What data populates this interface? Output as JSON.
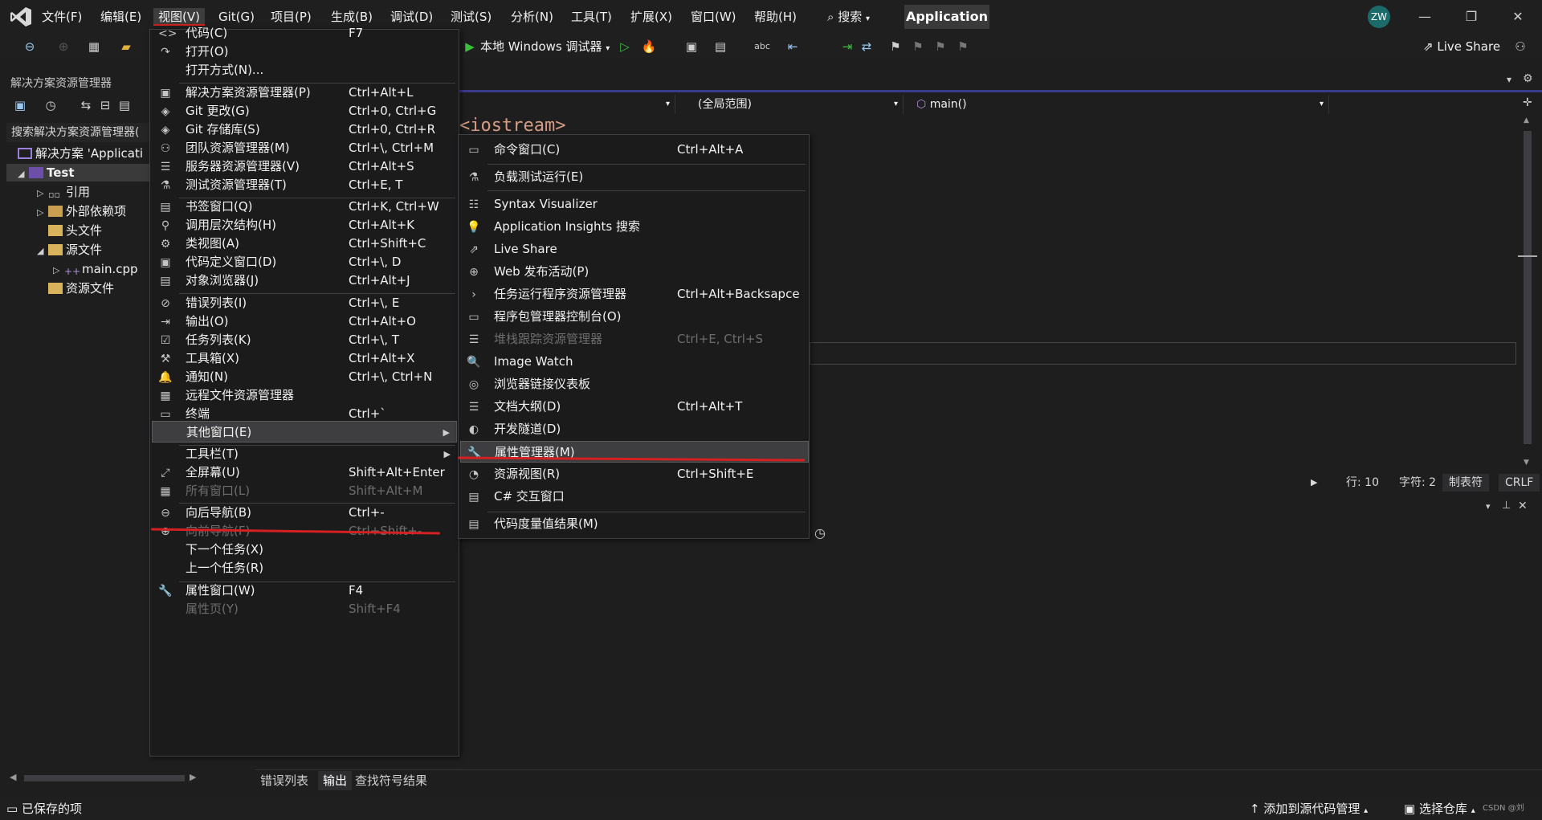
{
  "menubar": {
    "items": [
      "文件(F)",
      "编辑(E)",
      "视图(V)",
      "Git(G)",
      "项目(P)",
      "生成(B)",
      "调试(D)",
      "测试(S)",
      "分析(N)",
      "工具(T)",
      "扩展(X)",
      "窗口(W)",
      "帮助(H)"
    ],
    "search_label": "搜索",
    "app_title": "Application",
    "avatar_initials": "ZW"
  },
  "toolbar": {
    "debugger_label": "本地 Windows 调试器",
    "live_share_label": "Live Share"
  },
  "solution_explorer": {
    "title": "解决方案资源管理器",
    "search_placeholder": "搜索解决方案资源管理器(",
    "tree": [
      {
        "label": "解决方案 'Applicati",
        "level": 0,
        "arrow": ""
      },
      {
        "label": "Test",
        "level": 0,
        "arrow": "◢",
        "selected": true
      },
      {
        "label": "引用",
        "level": 1,
        "arrow": "▷"
      },
      {
        "label": "外部依赖项",
        "level": 1,
        "arrow": "▷"
      },
      {
        "label": "头文件",
        "level": 1,
        "arrow": ""
      },
      {
        "label": "源文件",
        "level": 1,
        "arrow": "◢"
      },
      {
        "label": "main.cpp",
        "level": 2,
        "arrow": "▷"
      },
      {
        "label": "资源文件",
        "level": 1,
        "arrow": ""
      }
    ]
  },
  "editor": {
    "scope_label": "(全局范围)",
    "function_label": "main()",
    "code_fragment": "<iostream>",
    "status": {
      "line": "行: 10",
      "char": "字符: 2",
      "tabs": "制表符",
      "eol": "CRLF"
    }
  },
  "output_tabs": [
    "错误列表",
    "输出",
    "查找符号结果"
  ],
  "statusbar": {
    "saved": "已保存的项",
    "add_source_control": "添加到源代码管理",
    "select_repo": "选择仓库",
    "watermark": "CSDN @刘"
  },
  "view_menu": {
    "items": [
      {
        "label": "代码(C)",
        "shortcut": "F7",
        "icon": "<>"
      },
      {
        "label": "打开(O)",
        "shortcut": "",
        "icon": "↷"
      },
      {
        "label": "打开方式(N)...",
        "shortcut": "",
        "icon": ""
      },
      {
        "label": "解决方案资源管理器(P)",
        "shortcut": "Ctrl+Alt+L",
        "icon": "▣"
      },
      {
        "label": "Git 更改(G)",
        "shortcut": "Ctrl+0, Ctrl+G",
        "icon": "◈"
      },
      {
        "label": "Git 存储库(S)",
        "shortcut": "Ctrl+0, Ctrl+R",
        "icon": "◈"
      },
      {
        "label": "团队资源管理器(M)",
        "shortcut": "Ctrl+\\, Ctrl+M",
        "icon": "⚇"
      },
      {
        "label": "服务器资源管理器(V)",
        "shortcut": "Ctrl+Alt+S",
        "icon": "☰"
      },
      {
        "label": "测试资源管理器(T)",
        "shortcut": "Ctrl+E, T",
        "icon": "⚗"
      },
      {
        "label": "书签窗口(Q)",
        "shortcut": "Ctrl+K, Ctrl+W",
        "icon": "▤"
      },
      {
        "label": "调用层次结构(H)",
        "shortcut": "Ctrl+Alt+K",
        "icon": "⚲"
      },
      {
        "label": "类视图(A)",
        "shortcut": "Ctrl+Shift+C",
        "icon": "⚙"
      },
      {
        "label": "代码定义窗口(D)",
        "shortcut": "Ctrl+\\, D",
        "icon": "▣"
      },
      {
        "label": "对象浏览器(J)",
        "shortcut": "Ctrl+Alt+J",
        "icon": "▤"
      },
      {
        "label": "错误列表(I)",
        "shortcut": "Ctrl+\\, E",
        "icon": "⊘"
      },
      {
        "label": "输出(O)",
        "shortcut": "Ctrl+Alt+O",
        "icon": "⇥"
      },
      {
        "label": "任务列表(K)",
        "shortcut": "Ctrl+\\, T",
        "icon": "☑"
      },
      {
        "label": "工具箱(X)",
        "shortcut": "Ctrl+Alt+X",
        "icon": "⚒"
      },
      {
        "label": "通知(N)",
        "shortcut": "Ctrl+\\, Ctrl+N",
        "icon": "🔔"
      },
      {
        "label": "远程文件资源管理器",
        "shortcut": "",
        "icon": "▦"
      },
      {
        "label": "终端",
        "shortcut": "Ctrl+`",
        "icon": "▭"
      },
      {
        "label": "其他窗口(E)",
        "shortcut": "",
        "icon": ""
      },
      {
        "label": "工具栏(T)",
        "shortcut": "",
        "icon": ""
      },
      {
        "label": "全屏幕(U)",
        "shortcut": "Shift+Alt+Enter",
        "icon": "⤢"
      },
      {
        "label": "所有窗口(L)",
        "shortcut": "Shift+Alt+M",
        "icon": "▦"
      },
      {
        "label": "向后导航(B)",
        "shortcut": "Ctrl+-",
        "icon": "⊖"
      },
      {
        "label": "向前导航(F)",
        "shortcut": "Ctrl+Shift+-",
        "icon": "⊕"
      },
      {
        "label": "下一个任务(X)",
        "shortcut": "",
        "icon": ""
      },
      {
        "label": "上一个任务(R)",
        "shortcut": "",
        "icon": ""
      },
      {
        "label": "属性窗口(W)",
        "shortcut": "F4",
        "icon": "🔧"
      },
      {
        "label": "属性页(Y)",
        "shortcut": "Shift+F4",
        "icon": ""
      }
    ]
  },
  "other_windows_menu": {
    "items": [
      {
        "label": "命令窗口(C)",
        "shortcut": "Ctrl+Alt+A",
        "icon": "▭"
      },
      {
        "label": "负载测试运行(E)",
        "shortcut": "",
        "icon": "⚗"
      },
      {
        "label": "Syntax Visualizer",
        "shortcut": "",
        "icon": "☷"
      },
      {
        "label": "Application Insights 搜索",
        "shortcut": "",
        "icon": "💡"
      },
      {
        "label": "Live Share",
        "shortcut": "",
        "icon": "⇗"
      },
      {
        "label": "Web 发布活动(P)",
        "shortcut": "",
        "icon": "⊕"
      },
      {
        "label": "任务运行程序资源管理器",
        "shortcut": "Ctrl+Alt+Backsapce",
        "icon": "›"
      },
      {
        "label": "程序包管理器控制台(O)",
        "shortcut": "",
        "icon": "▭"
      },
      {
        "label": "堆栈跟踪资源管理器",
        "shortcut": "Ctrl+E, Ctrl+S",
        "icon": "☰"
      },
      {
        "label": "Image Watch",
        "shortcut": "",
        "icon": "🔍"
      },
      {
        "label": "浏览器链接仪表板",
        "shortcut": "",
        "icon": "◎"
      },
      {
        "label": "文档大纲(D)",
        "shortcut": "Ctrl+Alt+T",
        "icon": "☰"
      },
      {
        "label": "开发隧道(D)",
        "shortcut": "",
        "icon": "◐"
      },
      {
        "label": "属性管理器(M)",
        "shortcut": "",
        "icon": "🔧"
      },
      {
        "label": "资源视图(R)",
        "shortcut": "Ctrl+Shift+E",
        "icon": "◔"
      },
      {
        "label": "C# 交互窗口",
        "shortcut": "",
        "icon": "▤"
      },
      {
        "label": "代码度量值结果(M)",
        "shortcut": "",
        "icon": "▤"
      }
    ]
  }
}
